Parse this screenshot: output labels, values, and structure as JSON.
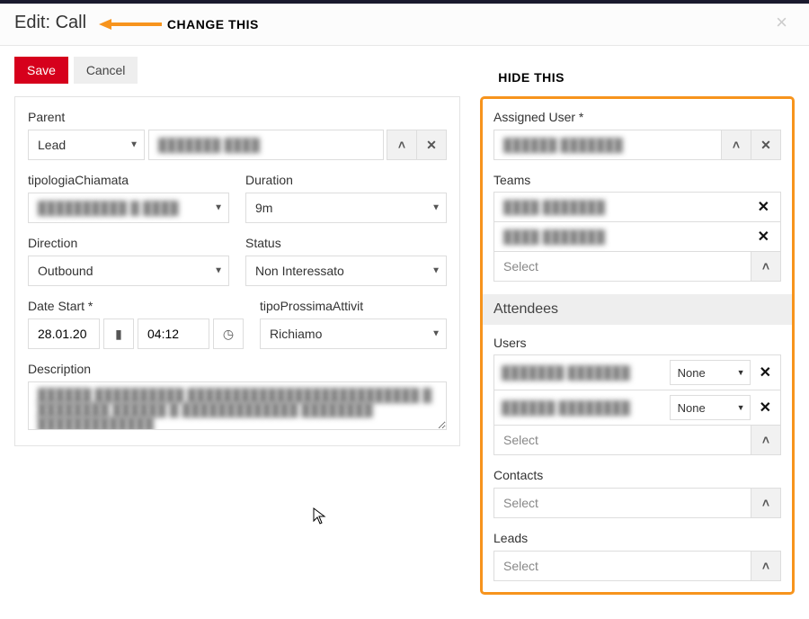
{
  "header": {
    "title": "Edit: Call",
    "annotation_change": "CHANGE THIS",
    "annotation_hide": "HIDE THIS"
  },
  "buttons": {
    "save": "Save",
    "cancel": "Cancel"
  },
  "left": {
    "parent_label": "Parent",
    "parent_type": "Lead",
    "parent_value": "███████ ████",
    "tipologia_label": "tipologiaChiamata",
    "tipologia_value": "██████████ █ ████",
    "duration_label": "Duration",
    "duration_value": "9m",
    "direction_label": "Direction",
    "direction_value": "Outbound",
    "status_label": "Status",
    "status_value": "Non Interessato",
    "date_start_label": "Date Start *",
    "date_start_date": "28.01.20",
    "date_start_time": "04:12",
    "tipo_prossima_label": "tipoProssimaAttivit",
    "tipo_prossima_value": "Richiamo",
    "description_label": "Description",
    "description_value": "██████ ██████████ ██████████████████████████ █ ████████ ██████ █ █████████████ ████████ █████████████"
  },
  "right": {
    "assigned_label": "Assigned User *",
    "assigned_value": "██████ ███████",
    "teams_label": "Teams",
    "teams": [
      "████ ███████",
      "████ ███████"
    ],
    "select_placeholder": "Select",
    "attendees_heading": "Attendees",
    "users_label": "Users",
    "users": [
      {
        "name": "███████ ███████",
        "status": "None"
      },
      {
        "name": "██████ ████████",
        "status": "None"
      }
    ],
    "contacts_label": "Contacts",
    "leads_label": "Leads"
  }
}
